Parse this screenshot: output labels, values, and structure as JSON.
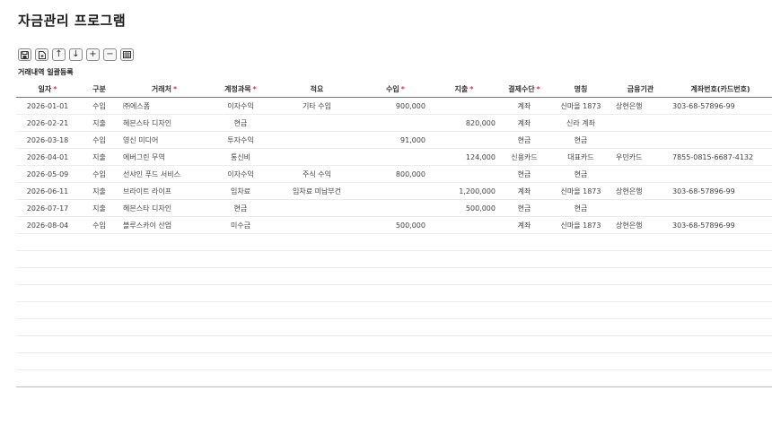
{
  "title": "자금관리 프로그램",
  "section_label": "거래내역 일괄등록",
  "toolbar": [
    {
      "icon": "save-icon",
      "glyph": ""
    },
    {
      "icon": "new-document-icon",
      "glyph": ""
    },
    {
      "icon": "arrow-up-icon",
      "glyph": "↑"
    },
    {
      "icon": "arrow-down-icon",
      "glyph": "↓"
    },
    {
      "icon": "plus-icon",
      "glyph": "+"
    },
    {
      "icon": "minus-icon",
      "glyph": "−"
    },
    {
      "icon": "grid-icon",
      "glyph": ""
    }
  ],
  "columns": [
    {
      "label": "일자",
      "required": true
    },
    {
      "label": "구분",
      "required": false
    },
    {
      "label": "거래처",
      "required": true
    },
    {
      "label": "계정과목",
      "required": true
    },
    {
      "label": "적요",
      "required": false
    },
    {
      "label": "수입",
      "required": true
    },
    {
      "label": "지출",
      "required": true
    },
    {
      "label": "결제수단",
      "required": true
    },
    {
      "label": "명칭",
      "required": false
    },
    {
      "label": "금융기관",
      "required": false
    },
    {
      "label": "계좌번호(카드번호)",
      "required": false
    }
  ],
  "required_mark": "*",
  "rows": [
    {
      "date": "2026-01-01",
      "type": "수입",
      "client": "㈜에스폼",
      "account": "이자수익",
      "memo": "기타 수입",
      "income": "900,000",
      "expense": "",
      "method": "계좌",
      "name": "신마을 1873",
      "bank": "상현은행",
      "acct": "303-68-57896-99"
    },
    {
      "date": "2026-02-21",
      "type": "지출",
      "client": "헤븐스타 디자인",
      "account": "현금",
      "memo": "",
      "income": "",
      "expense": "820,000",
      "method": "계좌",
      "name": "신라 계좌",
      "bank": "",
      "acct": ""
    },
    {
      "date": "2026-03-18",
      "type": "수입",
      "client": "영신 미디어",
      "account": "투자수익",
      "memo": "",
      "income": "91,000",
      "expense": "",
      "method": "현금",
      "name": "현금",
      "bank": "",
      "acct": ""
    },
    {
      "date": "2026-04-01",
      "type": "지출",
      "client": "에버그린 무역",
      "account": "통신비",
      "memo": "",
      "income": "",
      "expense": "124,000",
      "method": "신용카드",
      "name": "대표카드",
      "bank": "우민카드",
      "acct": "7855-0815-6687-4132"
    },
    {
      "date": "2026-05-09",
      "type": "수입",
      "client": "선샤인 푸드 서비스",
      "account": "이자수익",
      "memo": "주식 수익",
      "income": "800,000",
      "expense": "",
      "method": "현금",
      "name": "현금",
      "bank": "",
      "acct": ""
    },
    {
      "date": "2026-06-11",
      "type": "지출",
      "client": "브라이트 라이프",
      "account": "임차료",
      "memo": "임차료 미납부건",
      "income": "",
      "expense": "1,200,000",
      "method": "계좌",
      "name": "신마을 1873",
      "bank": "상현은행",
      "acct": "303-68-57896-99"
    },
    {
      "date": "2026-07-17",
      "type": "지출",
      "client": "헤븐스타 디자인",
      "account": "현금",
      "memo": "",
      "income": "",
      "expense": "500,000",
      "method": "현금",
      "name": "현금",
      "bank": "",
      "acct": ""
    },
    {
      "date": "2026-08-04",
      "type": "수입",
      "client": "블루스카이 산업",
      "account": "미수금",
      "memo": "",
      "income": "500,000",
      "expense": "",
      "method": "계좌",
      "name": "신마을 1873",
      "bank": "상현은행",
      "acct": "303-68-57896-99"
    }
  ],
  "empty_rows": 9,
  "colors": {
    "income": "#3d4aa8",
    "expense": "#c8364d",
    "required": "#d9364a"
  }
}
